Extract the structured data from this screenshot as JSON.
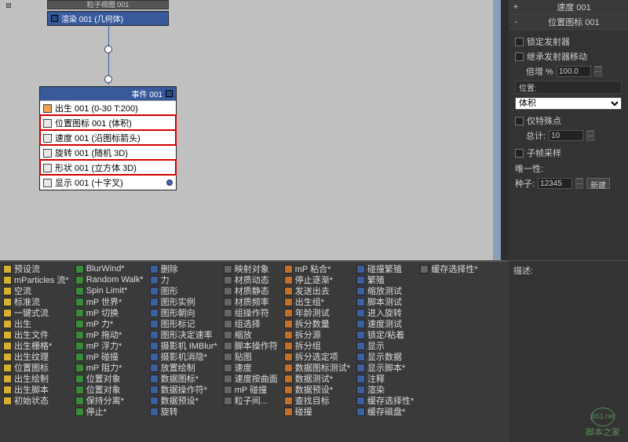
{
  "viewport": {
    "top_tab_label": "粒子视图 001"
  },
  "node_render": {
    "title": "渲染 001 (几何体)"
  },
  "node_event": {
    "title": "事件 001",
    "rows": [
      {
        "label": "出生 001 (0-30 T:200)",
        "icon_class": "birth",
        "highlight": false,
        "has_dot": false
      },
      {
        "label": "位置图标 001 (体积)",
        "icon_class": "",
        "highlight": true,
        "has_dot": false
      },
      {
        "label": "速度 001 (沿图标箭头)",
        "icon_class": "",
        "highlight": true,
        "has_dot": false
      },
      {
        "label": "旋转 001 (随机 3D)",
        "icon_class": "",
        "highlight": false,
        "has_dot": false
      },
      {
        "label": "形状 001 (立方体 3D)",
        "icon_class": "",
        "highlight": true,
        "has_dot": false
      },
      {
        "label": "显示 001 (十字叉)",
        "icon_class": "",
        "highlight": false,
        "has_dot": true
      }
    ]
  },
  "inspector": {
    "header1": "速度 001",
    "header2": "位置图标 001",
    "lock_emitter": "锁定发射器",
    "inherit_move": "继承发射器移动",
    "multiplier_label": "倍增 %",
    "multiplier_value": "100.0",
    "location_label": "位置:",
    "location_value": "体积",
    "special_points": "仅特殊点",
    "total_label": "总计:",
    "total_value": "10",
    "subframe": "子帧采样",
    "uniqueness": "唯一性:",
    "seed_label": "种子:",
    "seed_value": "12345",
    "new_btn": "新建"
  },
  "desc": {
    "title": "描述:"
  },
  "operators": {
    "col0": [
      "预设流",
      "mParticles 流*",
      "空流",
      "标准流",
      "一键式流",
      "出生",
      "出生文件",
      "出生栅格*",
      "出生纹理",
      "位置图标",
      "出生绘制",
      "出生脚本",
      "初始状态"
    ],
    "col1": [
      "BlurWind*",
      "Random Walk*",
      "Spin Limit*",
      "mP 世界*",
      "mP 切换",
      "mP 力*",
      "mP 拖动*",
      "mP 浮力*",
      "mP 碰撞",
      "mP 阻力*",
      "位置对象",
      "位置对象",
      "保持分离*",
      "停止*"
    ],
    "col2": [
      "删除",
      "力",
      "图形",
      "图形实例",
      "图形朝向",
      "图形标记",
      "图形决定速率",
      "摄影机 IMBlur*",
      "摄影机消隐*",
      "放置绘制",
      "数据图标*",
      "数据操作符*",
      "数据预设*",
      "旋转"
    ],
    "col3": [
      "映射对象",
      "材质动态",
      "材质静态",
      "材质频率",
      "组操作符",
      "组选择",
      "缩放",
      "脚本操作符",
      "贴图",
      "速度",
      "速度按曲面",
      "mP 碰撞",
      "粒子间..."
    ],
    "col4": [
      "mP 粘合*",
      "停止逐渐*",
      "发送出去",
      "出生组*",
      "年龄测试",
      "拆分数量",
      "拆分源",
      "拆分组",
      "拆分选定项",
      "数据图标测试*",
      "数据测试*",
      "数据预设*",
      "查找目标",
      "碰撞"
    ],
    "col5": [
      "碰撞繁殖",
      "繁殖",
      "缩放测试",
      "脚本测试",
      "进入旋转",
      "速度测试",
      "锁定/粘着",
      "显示",
      "显示数据",
      "显示脚本*",
      "注释",
      "渲染",
      "缓存选择性*",
      "缓存磁盘*"
    ],
    "col6": [
      "缓存选择性*"
    ]
  },
  "watermark": {
    "site": "jb51.net",
    "text": "脚本之家"
  }
}
